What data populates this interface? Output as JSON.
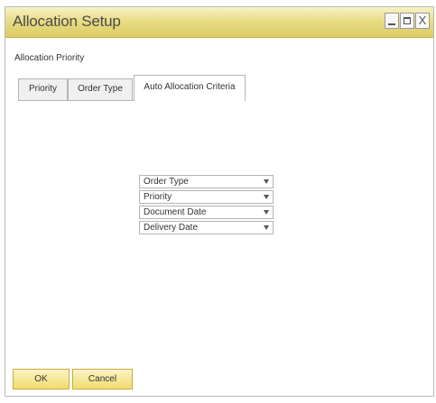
{
  "window": {
    "title": "Allocation Setup",
    "controls": {
      "close_glyph": "X"
    }
  },
  "section_label": "Allocation Priority",
  "tabs": [
    {
      "label": "Priority",
      "active": false
    },
    {
      "label": "Order Type",
      "active": false
    },
    {
      "label": "Auto Allocation Criteria",
      "active": true
    }
  ],
  "criteria": [
    {
      "value": "Order Type"
    },
    {
      "value": "Priority"
    },
    {
      "value": "Document Date"
    },
    {
      "value": "Delivery Date"
    }
  ],
  "buttons": {
    "ok": "OK",
    "cancel": "Cancel"
  },
  "colors": {
    "titlebar": "#e9dc86",
    "button": "#f2dc6e",
    "border": "#b4b4b4"
  }
}
